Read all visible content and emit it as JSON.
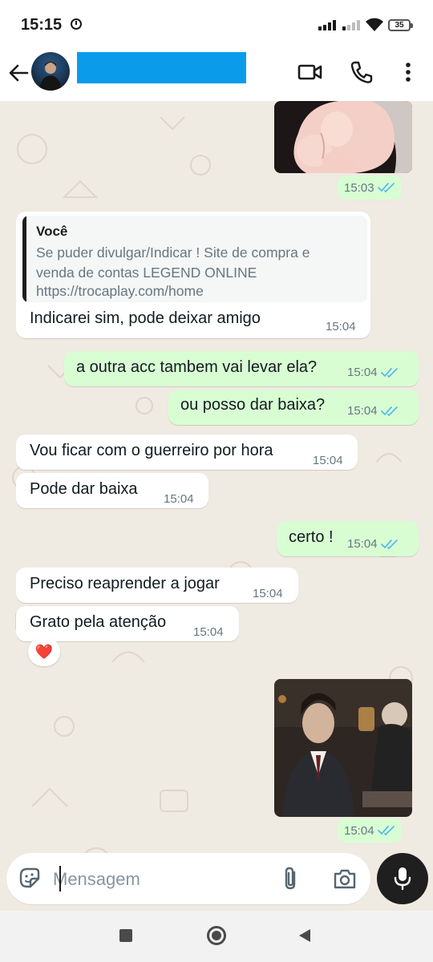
{
  "status": {
    "time": "15:15",
    "battery": "35"
  },
  "header": {
    "contact_name": ""
  },
  "messages": {
    "img1_time": "15:03",
    "quote_author": "Você",
    "quote_line1": "Se puder divulgar/Indicar ! Site de compra e",
    "quote_line2": "venda de contas LEGEND ONLINE",
    "quote_line3": "https://trocaplay.com/home",
    "m1_text": "Indicarei sim, pode deixar amigo",
    "m1_time": "15:04",
    "m2_text": "a outra acc tambem vai levar ela?",
    "m2_time": "15:04",
    "m3_text": "ou posso dar baixa?",
    "m3_time": "15:04",
    "m4_text": "Vou ficar com o guerreiro por hora",
    "m4_time": "15:04",
    "m5_text": "Pode dar baixa",
    "m5_time": "15:04",
    "m6_text": "certo !",
    "m6_time": "15:04",
    "m7_text": "Preciso reaprender a jogar",
    "m7_time": "15:04",
    "m8_text": "Grato pela atenção",
    "m8_time": "15:04",
    "m8_reaction": "❤️",
    "img2_time": "15:04"
  },
  "input": {
    "placeholder": "Mensagem"
  },
  "colors": {
    "outgoing_bubble": "#d9fdd3",
    "incoming_bubble": "#ffffff",
    "chat_background": "#efeae2",
    "read_ticks": "#53bdeb",
    "name_redaction": "#0a9cea"
  },
  "icons": {
    "back": "arrow-left-icon",
    "video_call": "video-camera-icon",
    "voice_call": "phone-icon",
    "menu": "more-vertical-icon",
    "sticker": "sticker-icon",
    "attach": "paperclip-icon",
    "camera": "camera-icon",
    "mic": "microphone-icon",
    "nav_back": "triangle-back-icon",
    "nav_home": "circle-home-icon",
    "nav_recent": "square-recents-icon"
  }
}
